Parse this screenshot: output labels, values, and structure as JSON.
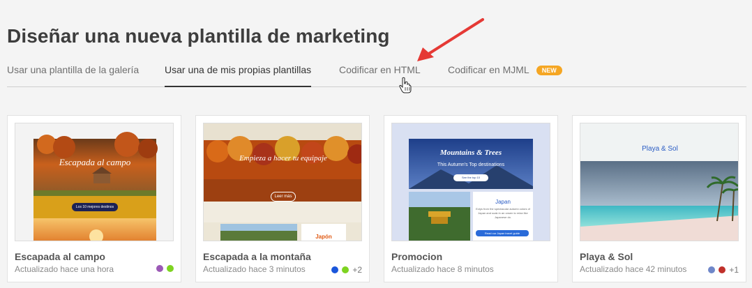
{
  "page_title": "Diseñar una nueva plantilla de marketing",
  "tabs": [
    {
      "label": "Usar una plantilla de la galería"
    },
    {
      "label": "Usar una de mis propias plantillas",
      "active": true
    },
    {
      "label": "Codificar en HTML"
    },
    {
      "label": "Codificar en MJML",
      "badge": "NEW"
    }
  ],
  "cards": [
    {
      "title": "Escapada al campo",
      "subtitle": "Actualizado hace una hora",
      "colors": [
        "#9b59b6",
        "#7ed321"
      ],
      "extra": "",
      "thumb": {
        "heading": "Escapada al campo",
        "button": "Los 10 mejores destinos"
      }
    },
    {
      "title": "Escapada a la montaña",
      "subtitle": "Actualizado hace 3 minutos",
      "colors": [
        "#1a56db",
        "#7ed321"
      ],
      "extra": "+2",
      "thumb": {
        "heading": "Empieza a hacer tu equipaje",
        "button": "Leer más",
        "section": "Japón"
      }
    },
    {
      "title": "Promocion",
      "subtitle": "Actualizado hace 8 minutos",
      "colors": [],
      "extra": "",
      "thumb": {
        "heading": "Mountains & Trees",
        "subheading": "This Autumn's Top destinations",
        "button": "See the top 10",
        "section": "Japan",
        "body": "Ectys from the spectacular autumn colors of Japan and soak in an onsen to relax like Japanese do.",
        "cta": "Read our Japan travel guide"
      }
    },
    {
      "title": "Playa & Sol",
      "subtitle": "Actualizado hace 42 minutos",
      "colors": [
        "#6f87c9",
        "#c0302a"
      ],
      "extra": "+1",
      "thumb": {
        "heading": "Playa & Sol"
      }
    }
  ],
  "icons": {
    "arrow": "red-arrow-icon",
    "cursor": "hand-pointer-icon"
  }
}
